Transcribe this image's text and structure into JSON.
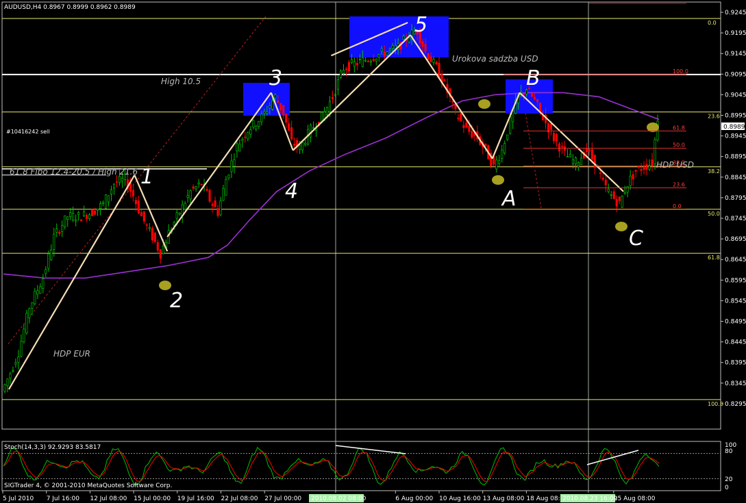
{
  "header": {
    "symbol_line": "AUDUSD,H4  0.8967 0.8999 0.8962 0.8989"
  },
  "colors": {
    "background": "#000000",
    "bull": "#00c000",
    "bear": "#ff0000",
    "ma": "#9b30d0",
    "level": "#e8e870",
    "wave_line": "#f5deb3",
    "box": "#1010ff",
    "marker": "#a8a020",
    "grid": "#c8d8c8"
  },
  "chart_data": {
    "type": "candlestick",
    "symbol": "AUDUSD",
    "timeframe": "H4",
    "ohlc": {
      "open": 0.8967,
      "high": 0.8999,
      "low": 0.8962,
      "close": 0.8989
    },
    "current_price": "0.8989",
    "ylim": [
      0.8275,
      0.9265
    ],
    "price_ticks": [
      "0.9245",
      "0.9195",
      "0.9145",
      "0.9095",
      "0.9045",
      "0.8995",
      "0.8945",
      "0.8895",
      "0.8845",
      "0.8795",
      "0.8745",
      "0.8695",
      "0.8645",
      "0.8595",
      "0.8545",
      "0.8495",
      "0.8445",
      "0.8395",
      "0.8345",
      "0.8295"
    ],
    "time_ticks": [
      "5 Jul 2010",
      "7 Jul 16:00",
      "12 Jul 08:00",
      "15 Jul 00:00",
      "19 Jul 16:00",
      "22 Jul 08:00",
      "27 Jul 00:00",
      "",
      "",
      "6 Aug 00:00",
      "10 Aug 16:00",
      "13 Aug 08:00",
      "18 Aug 08:00",
      "",
      "25 Aug 08:00"
    ],
    "time_cursor_labels": [
      "2010.08.02 08:00",
      "2010.08.23 16:00"
    ],
    "path_keypoints": [
      {
        "t": 0,
        "p": 0.8325
      },
      {
        "t": 3,
        "p": 0.837
      },
      {
        "t": 6,
        "p": 0.842
      },
      {
        "t": 10,
        "p": 0.853
      },
      {
        "t": 15,
        "p": 0.86
      },
      {
        "t": 19,
        "p": 0.87
      },
      {
        "t": 24,
        "p": 0.875
      },
      {
        "t": 29,
        "p": 0.875
      },
      {
        "t": 33,
        "p": 0.876
      },
      {
        "t": 37,
        "p": 0.878
      },
      {
        "t": 41,
        "p": 0.883
      },
      {
        "t": 45,
        "p": 0.884
      },
      {
        "t": 48,
        "p": 0.88
      },
      {
        "t": 51,
        "p": 0.875
      },
      {
        "t": 55,
        "p": 0.87
      },
      {
        "t": 58,
        "p": 0.866
      },
      {
        "t": 61,
        "p": 0.871
      },
      {
        "t": 65,
        "p": 0.876
      },
      {
        "t": 69,
        "p": 0.881
      },
      {
        "t": 73,
        "p": 0.883
      },
      {
        "t": 76,
        "p": 0.879
      },
      {
        "t": 79,
        "p": 0.876
      },
      {
        "t": 82,
        "p": 0.884
      },
      {
        "t": 86,
        "p": 0.892
      },
      {
        "t": 90,
        "p": 0.896
      },
      {
        "t": 95,
        "p": 0.899
      },
      {
        "t": 100,
        "p": 0.904
      },
      {
        "t": 103,
        "p": 0.9
      },
      {
        "t": 106,
        "p": 0.893
      },
      {
        "t": 109,
        "p": 0.8915
      },
      {
        "t": 113,
        "p": 0.896
      },
      {
        "t": 117,
        "p": 0.899
      },
      {
        "t": 121,
        "p": 0.904
      },
      {
        "t": 125,
        "p": 0.911
      },
      {
        "t": 129,
        "p": 0.912
      },
      {
        "t": 133,
        "p": 0.913
      },
      {
        "t": 137,
        "p": 0.914
      },
      {
        "t": 141,
        "p": 0.915
      },
      {
        "t": 145,
        "p": 0.916
      },
      {
        "t": 149,
        "p": 0.919
      },
      {
        "t": 152,
        "p": 0.92
      },
      {
        "t": 155,
        "p": 0.915
      },
      {
        "t": 159,
        "p": 0.911
      },
      {
        "t": 162,
        "p": 0.907
      },
      {
        "t": 166,
        "p": 0.9
      },
      {
        "t": 170,
        "p": 0.896
      },
      {
        "t": 174,
        "p": 0.894
      },
      {
        "t": 177,
        "p": 0.891
      },
      {
        "t": 180,
        "p": 0.887
      },
      {
        "t": 183,
        "p": 0.891
      },
      {
        "t": 186,
        "p": 0.898
      },
      {
        "t": 189,
        "p": 0.904
      },
      {
        "t": 192,
        "p": 0.906
      },
      {
        "t": 195,
        "p": 0.903
      },
      {
        "t": 198,
        "p": 0.899
      },
      {
        "t": 202,
        "p": 0.894
      },
      {
        "t": 206,
        "p": 0.89
      },
      {
        "t": 210,
        "p": 0.888
      },
      {
        "t": 214,
        "p": 0.891
      },
      {
        "t": 217,
        "p": 0.888
      },
      {
        "t": 220,
        "p": 0.883
      },
      {
        "t": 223,
        "p": 0.88
      },
      {
        "t": 226,
        "p": 0.878
      },
      {
        "t": 229,
        "p": 0.883
      },
      {
        "t": 232,
        "p": 0.886
      },
      {
        "t": 235,
        "p": 0.887
      },
      {
        "t": 238,
        "p": 0.888
      },
      {
        "t": 240,
        "p": 0.899
      }
    ],
    "moving_average": [
      {
        "t": 0,
        "p": 0.861
      },
      {
        "t": 15,
        "p": 0.86
      },
      {
        "t": 30,
        "p": 0.86
      },
      {
        "t": 45,
        "p": 0.8615
      },
      {
        "t": 60,
        "p": 0.863
      },
      {
        "t": 75,
        "p": 0.865
      },
      {
        "t": 82,
        "p": 0.868
      },
      {
        "t": 90,
        "p": 0.874
      },
      {
        "t": 100,
        "p": 0.881
      },
      {
        "t": 112,
        "p": 0.886
      },
      {
        "t": 125,
        "p": 0.89
      },
      {
        "t": 140,
        "p": 0.894
      },
      {
        "t": 155,
        "p": 0.899
      },
      {
        "t": 168,
        "p": 0.903
      },
      {
        "t": 180,
        "p": 0.9045
      },
      {
        "t": 192,
        "p": 0.905
      },
      {
        "t": 205,
        "p": 0.905
      },
      {
        "t": 218,
        "p": 0.904
      },
      {
        "t": 230,
        "p": 0.901
      },
      {
        "t": 240,
        "p": 0.8985
      }
    ],
    "wave_lines": [
      {
        "t1": 2,
        "p1": 0.833,
        "t2": 48,
        "p2": 0.885
      },
      {
        "t1": 48,
        "p1": 0.885,
        "t2": 60,
        "p2": 0.8665
      },
      {
        "t1": 60,
        "p1": 0.87,
        "t2": 98,
        "p2": 0.905
      },
      {
        "t1": 98,
        "p1": 0.905,
        "t2": 106,
        "p2": 0.891
      },
      {
        "t1": 106,
        "p1": 0.891,
        "t2": 149,
        "p2": 0.919
      },
      {
        "t1": 149,
        "p1": 0.919,
        "t2": 179,
        "p2": 0.889
      },
      {
        "t1": 179,
        "p1": 0.889,
        "t2": 189,
        "p2": 0.905
      },
      {
        "t1": 189,
        "p1": 0.905,
        "t2": 227,
        "p2": 0.881
      },
      {
        "t1": 120,
        "p1": 0.914,
        "t2": 148,
        "p2": 0.922
      }
    ],
    "horizontal_levels": [
      {
        "p": 0.923,
        "label": "0.0"
      },
      {
        "p": 0.9094
      },
      {
        "p": 0.9003,
        "label": "23.6"
      },
      {
        "p": 0.887,
        "label": "38.2"
      },
      {
        "p": 0.8767,
        "label": "50.0"
      },
      {
        "p": 0.866,
        "label": "61.8"
      },
      {
        "p": 0.8305,
        "label": "100.0"
      }
    ],
    "fib_levels": [
      {
        "p": 0.9094,
        "label": "100.0"
      },
      {
        "p": 0.8957,
        "label": "61.8"
      },
      {
        "p": 0.8915,
        "label": "50.0"
      },
      {
        "p": 0.8872,
        "label": "38.2"
      },
      {
        "p": 0.8819,
        "label": "23.6"
      },
      {
        "p": 0.8767,
        "label": "0.0"
      }
    ],
    "wave_labels": [
      "1",
      "2",
      "3",
      "4",
      "5",
      "A",
      "B",
      "C"
    ],
    "annotations": {
      "high": "High 10.5",
      "fibo": "61.8 Fibo 12.4-20.5 / High 21.6",
      "hdp_eur": "HDP EUR",
      "hdp_usd": "HDP USD",
      "rate": "Urokova sadzba USD",
      "order": "#10416242 sell"
    },
    "stochastic": {
      "label": "Stoch(14,3,3) 92.9293 83.5817",
      "main": 92.9293,
      "signal": 83.5817,
      "levels": [
        80,
        20
      ],
      "scale_labels": [
        "100",
        "80",
        "20",
        "0"
      ]
    }
  },
  "footer": {
    "copyright": "SIGTrader 4, © 2001-2010 MetaQuotes Software Corp."
  }
}
